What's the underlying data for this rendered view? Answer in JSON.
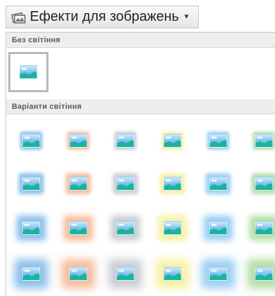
{
  "dropdown": {
    "label": "Ефекти для зображень",
    "icon": "picture-effects-icon",
    "caret": "chevron-down-icon"
  },
  "sections": {
    "no_glow": "Без світіння",
    "variants": "Варіанти світіння"
  },
  "glow_colors": [
    "#2b8ad8",
    "#f0834a",
    "#9aa3ad",
    "#f3e35a",
    "#46a6e8",
    "#76c25a"
  ],
  "glow_rows": [
    "small",
    "medium",
    "large",
    "extra-large"
  ]
}
